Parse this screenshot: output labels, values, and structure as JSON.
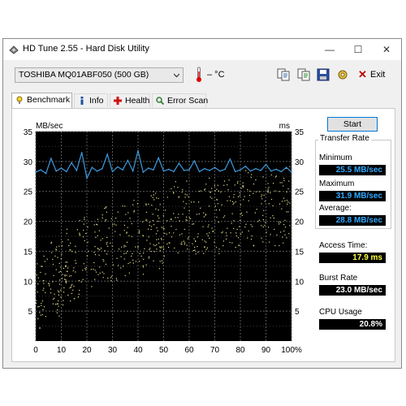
{
  "window": {
    "title": "HD Tune 2.55 - Hard Disk Utility",
    "controls": {
      "minimize": "—",
      "maximize": "☐",
      "close": "✕"
    }
  },
  "toolbar": {
    "drive": "TOSHIBA MQ01ABF050 (500 GB)",
    "temperature": "– °C",
    "icons": [
      "copy-text-icon",
      "copy-info-icon",
      "save-icon",
      "options-icon"
    ],
    "exit_label": "Exit"
  },
  "tabs": [
    {
      "label": "Benchmark",
      "icon": "benchmark-icon",
      "active": true
    },
    {
      "label": "Info",
      "icon": "info-icon",
      "active": false
    },
    {
      "label": "Health",
      "icon": "health-icon",
      "active": false
    },
    {
      "label": "Error Scan",
      "icon": "error-scan-icon",
      "active": false
    }
  ],
  "benchmark": {
    "start_label": "Start",
    "transfer_rate_title": "Transfer Rate",
    "minimum_label": "Minimum",
    "minimum_value": "25.5 MB/sec",
    "maximum_label": "Maximum",
    "maximum_value": "31.9 MB/sec",
    "average_label": "Average:",
    "average_value": "28.8 MB/sec",
    "access_time_label": "Access Time:",
    "access_time_value": "17.9 ms",
    "burst_rate_label": "Burst Rate",
    "burst_rate_value": "23.0 MB/sec",
    "cpu_usage_label": "CPU Usage",
    "cpu_usage_value": "20.8%"
  },
  "chart_data": {
    "type": "line",
    "y_left_label": "MB/sec",
    "y_right_label": "ms",
    "ylim": [
      0,
      35
    ],
    "xlim": [
      0,
      100
    ],
    "y_ticks": [
      "5",
      "10",
      "15",
      "20",
      "25",
      "30",
      "35"
    ],
    "x_ticks": [
      "0",
      "10",
      "20",
      "30",
      "40",
      "50",
      "60",
      "70",
      "80",
      "90",
      "100%"
    ],
    "grid": true,
    "colors": {
      "background": "#000000",
      "grid": "#5a5a5a",
      "transfer": "#3c9bde",
      "access": "#e6e08c"
    },
    "series": [
      {
        "kind": "transfer-rate",
        "x": [
          0,
          2,
          4,
          6,
          8,
          10,
          12,
          14,
          16,
          18,
          20,
          22,
          24,
          26,
          28,
          30,
          32,
          34,
          36,
          38,
          40,
          42,
          44,
          46,
          48,
          50,
          52,
          54,
          56,
          58,
          60,
          62,
          64,
          66,
          68,
          70,
          72,
          74,
          76,
          78,
          80,
          82,
          84,
          86,
          88,
          90,
          92,
          94,
          96,
          98,
          100
        ],
        "values": [
          28.2,
          28.6,
          28.0,
          30.5,
          28.4,
          28.9,
          28.3,
          29.8,
          28.5,
          31.5,
          27.2,
          29.0,
          28.4,
          28.8,
          31.2,
          28.3,
          29.1,
          28.6,
          30.2,
          28.4,
          31.8,
          28.2,
          28.9,
          28.6,
          30.6,
          28.4,
          28.7,
          28.3,
          29.7,
          28.5,
          28.6,
          30.1,
          28.3,
          28.8,
          28.5,
          29.0,
          28.4,
          28.7,
          30.4,
          28.3,
          28.6,
          29.2,
          28.4,
          28.8,
          28.5,
          29.5,
          28.4,
          28.7,
          28.3,
          29.0,
          28.2
        ]
      },
      {
        "kind": "access-time-ms",
        "x": [
          0,
          3,
          6,
          9,
          12,
          15,
          18,
          21,
          24,
          27,
          30,
          33,
          36,
          39,
          42,
          45,
          48,
          51,
          54,
          57,
          60,
          63,
          66,
          69,
          72,
          75,
          78,
          81,
          84,
          87,
          90,
          93,
          96,
          99
        ],
        "values": [
          7,
          9,
          12,
          10,
          14,
          11,
          16,
          13,
          15,
          17,
          14,
          18,
          16,
          19,
          17,
          20,
          18,
          19,
          21,
          20,
          22,
          19,
          21,
          23,
          20,
          22,
          21,
          23,
          22,
          21,
          23,
          22,
          22,
          24
        ]
      }
    ]
  }
}
